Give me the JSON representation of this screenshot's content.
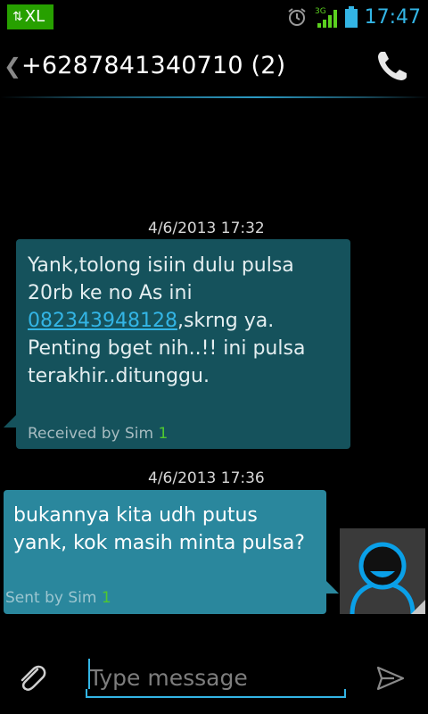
{
  "status_bar": {
    "carrier": "XL",
    "data_arrows": "⇅",
    "network": "3G",
    "time": "17:47",
    "icons": [
      "data-activity-icon",
      "alarm-icon",
      "signal-3g-icon",
      "battery-icon"
    ]
  },
  "header": {
    "back_glyph": "❮",
    "title": "+6287841340710 (2)",
    "call_icon": "phone-icon"
  },
  "messages": [
    {
      "direction": "received",
      "timestamp": "4/6/2013 17:32",
      "text_before": "Yank,tolong isiin dulu pulsa 20rb ke no As ini ",
      "link": "082343948128",
      "text_after": ",skrng ya. Penting bget nih..!! ini pulsa terakhir..ditunggu.",
      "meta": "Received by Sim ",
      "sim": "1"
    },
    {
      "direction": "sent",
      "timestamp": "4/6/2013 17:36",
      "text": "bukannya kita udh putus yank, kok masih minta pulsa?",
      "meta": "Sent by Sim ",
      "sim": "1"
    }
  ],
  "compose": {
    "placeholder": "Type message",
    "attach_icon": "paperclip-icon",
    "send_icon": "send-icon"
  },
  "colors": {
    "accent": "#33b5e5",
    "carrier_bg": "#27a000",
    "received_bubble": "#15525c",
    "sent_bubble": "#2a879d",
    "sim_green": "#4fc82f"
  }
}
